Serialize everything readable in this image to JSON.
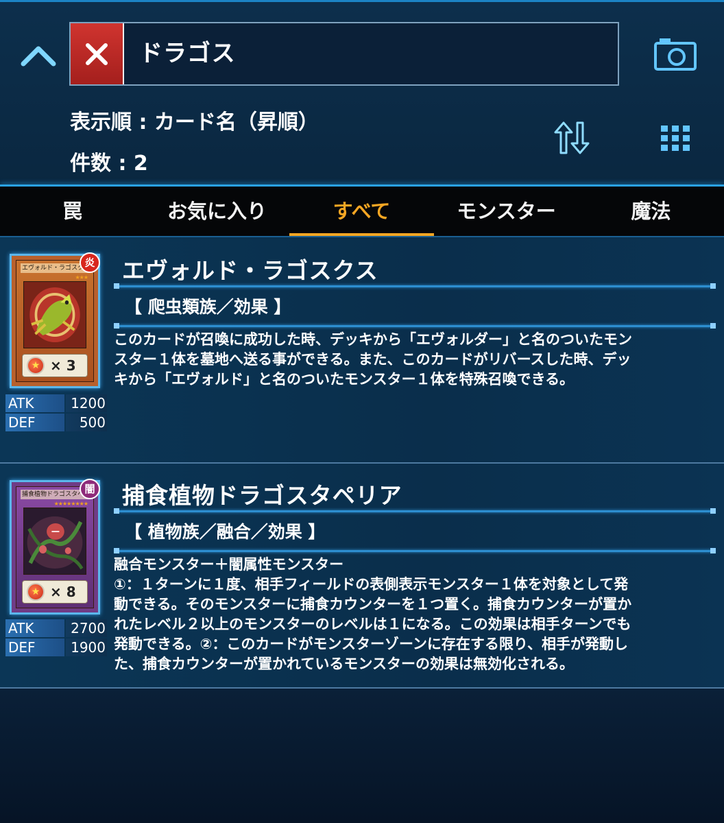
{
  "search": {
    "query": "ドラゴス"
  },
  "sort": {
    "text": "表示順 : カード名（昇順）"
  },
  "count": {
    "text": "件数 : 2"
  },
  "tabs": [
    {
      "label": "罠"
    },
    {
      "label": "お気に入り"
    },
    {
      "label": "すべて",
      "active": true
    },
    {
      "label": "モンスター"
    },
    {
      "label": "魔法"
    }
  ],
  "cards": [
    {
      "name": "エヴォルド・ラゴスクス",
      "art_name": "エヴォルド・ラゴスクス",
      "type": "【 爬虫類族／効果 】",
      "attribute": "炎",
      "attribute_color": "#d8261d",
      "level_text": "× 3",
      "atk_label": "ATK",
      "atk": "1200",
      "def_label": "DEF",
      "def": "500",
      "desc": [
        "このカードが召喚に成功した時、デッキから「エヴォルダー」と名のついたモン",
        "スター１体を墓地へ送る事ができる。また、このカードがリバースした時、デッ",
        "キから「エヴォルド」と名のついたモンスター１体を特殊召喚できる。"
      ]
    },
    {
      "name": "捕食植物ドラゴスタペリア",
      "art_name": "捕食植物ドラゴスタペリア",
      "type": "【 植物族／融合／効果 】",
      "attribute": "闇",
      "attribute_color": "#8e2a7a",
      "level_text": "× 8",
      "atk_label": "ATK",
      "atk": "2700",
      "def_label": "DEF",
      "def": "1900",
      "desc": [
        "融合モンスター＋闇属性モンスター",
        "①：１ターンに１度、相手フィールドの表側表示モンスター１体を対象として発",
        "動できる。そのモンスターに捕食カウンターを１つ置く。捕食カウンターが置か",
        "れたレベル２以上のモンスターのレベルは１になる。この効果は相手ターンでも",
        "発動できる。②：このカードがモンスターゾーンに存在する限り、相手が発動し",
        "た、捕食カウンターが置かれているモンスターの効果は無効化される。"
      ]
    }
  ],
  "colors": {
    "accent": "#2aa2e6",
    "tab_active": "#f5a623",
    "clear_button": "#c52b27"
  }
}
